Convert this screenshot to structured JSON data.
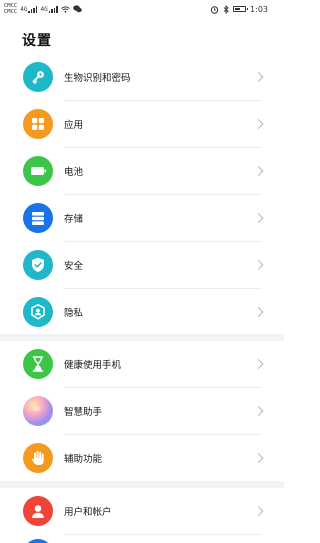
{
  "status_bar": {
    "carrier_top": "CMCC",
    "carrier_bottom": "CMCC",
    "sig1": "4G",
    "sig2": "4G",
    "time": "1:03",
    "battery_level": 0.6
  },
  "page": {
    "title": "设置"
  },
  "groups": [
    {
      "items": [
        {
          "label": "生物识别和密码",
          "icon": "key-icon",
          "color": "#1fb8c8"
        },
        {
          "label": "应用",
          "icon": "apps-grid-icon",
          "color": "#f59a1f"
        },
        {
          "label": "电池",
          "icon": "battery-icon",
          "color": "#3dc54a"
        },
        {
          "label": "存储",
          "icon": "storage-icon",
          "color": "#1a73e8"
        },
        {
          "label": "安全",
          "icon": "shield-check-icon",
          "color": "#1fb8c8"
        },
        {
          "label": "隐私",
          "icon": "privacy-icon",
          "color": "#1fb8c8"
        }
      ]
    },
    {
      "items": [
        {
          "label": "健康使用手机",
          "icon": "hourglass-icon",
          "color": "#3dc54a"
        },
        {
          "label": "智慧助手",
          "icon": "assistant-orb-icon",
          "color": "#b48be8"
        },
        {
          "label": "辅助功能",
          "icon": "hand-icon",
          "color": "#f59a1f"
        }
      ]
    },
    {
      "items": [
        {
          "label": "用户和帐户",
          "icon": "user-icon",
          "color": "#f04438"
        }
      ]
    }
  ]
}
